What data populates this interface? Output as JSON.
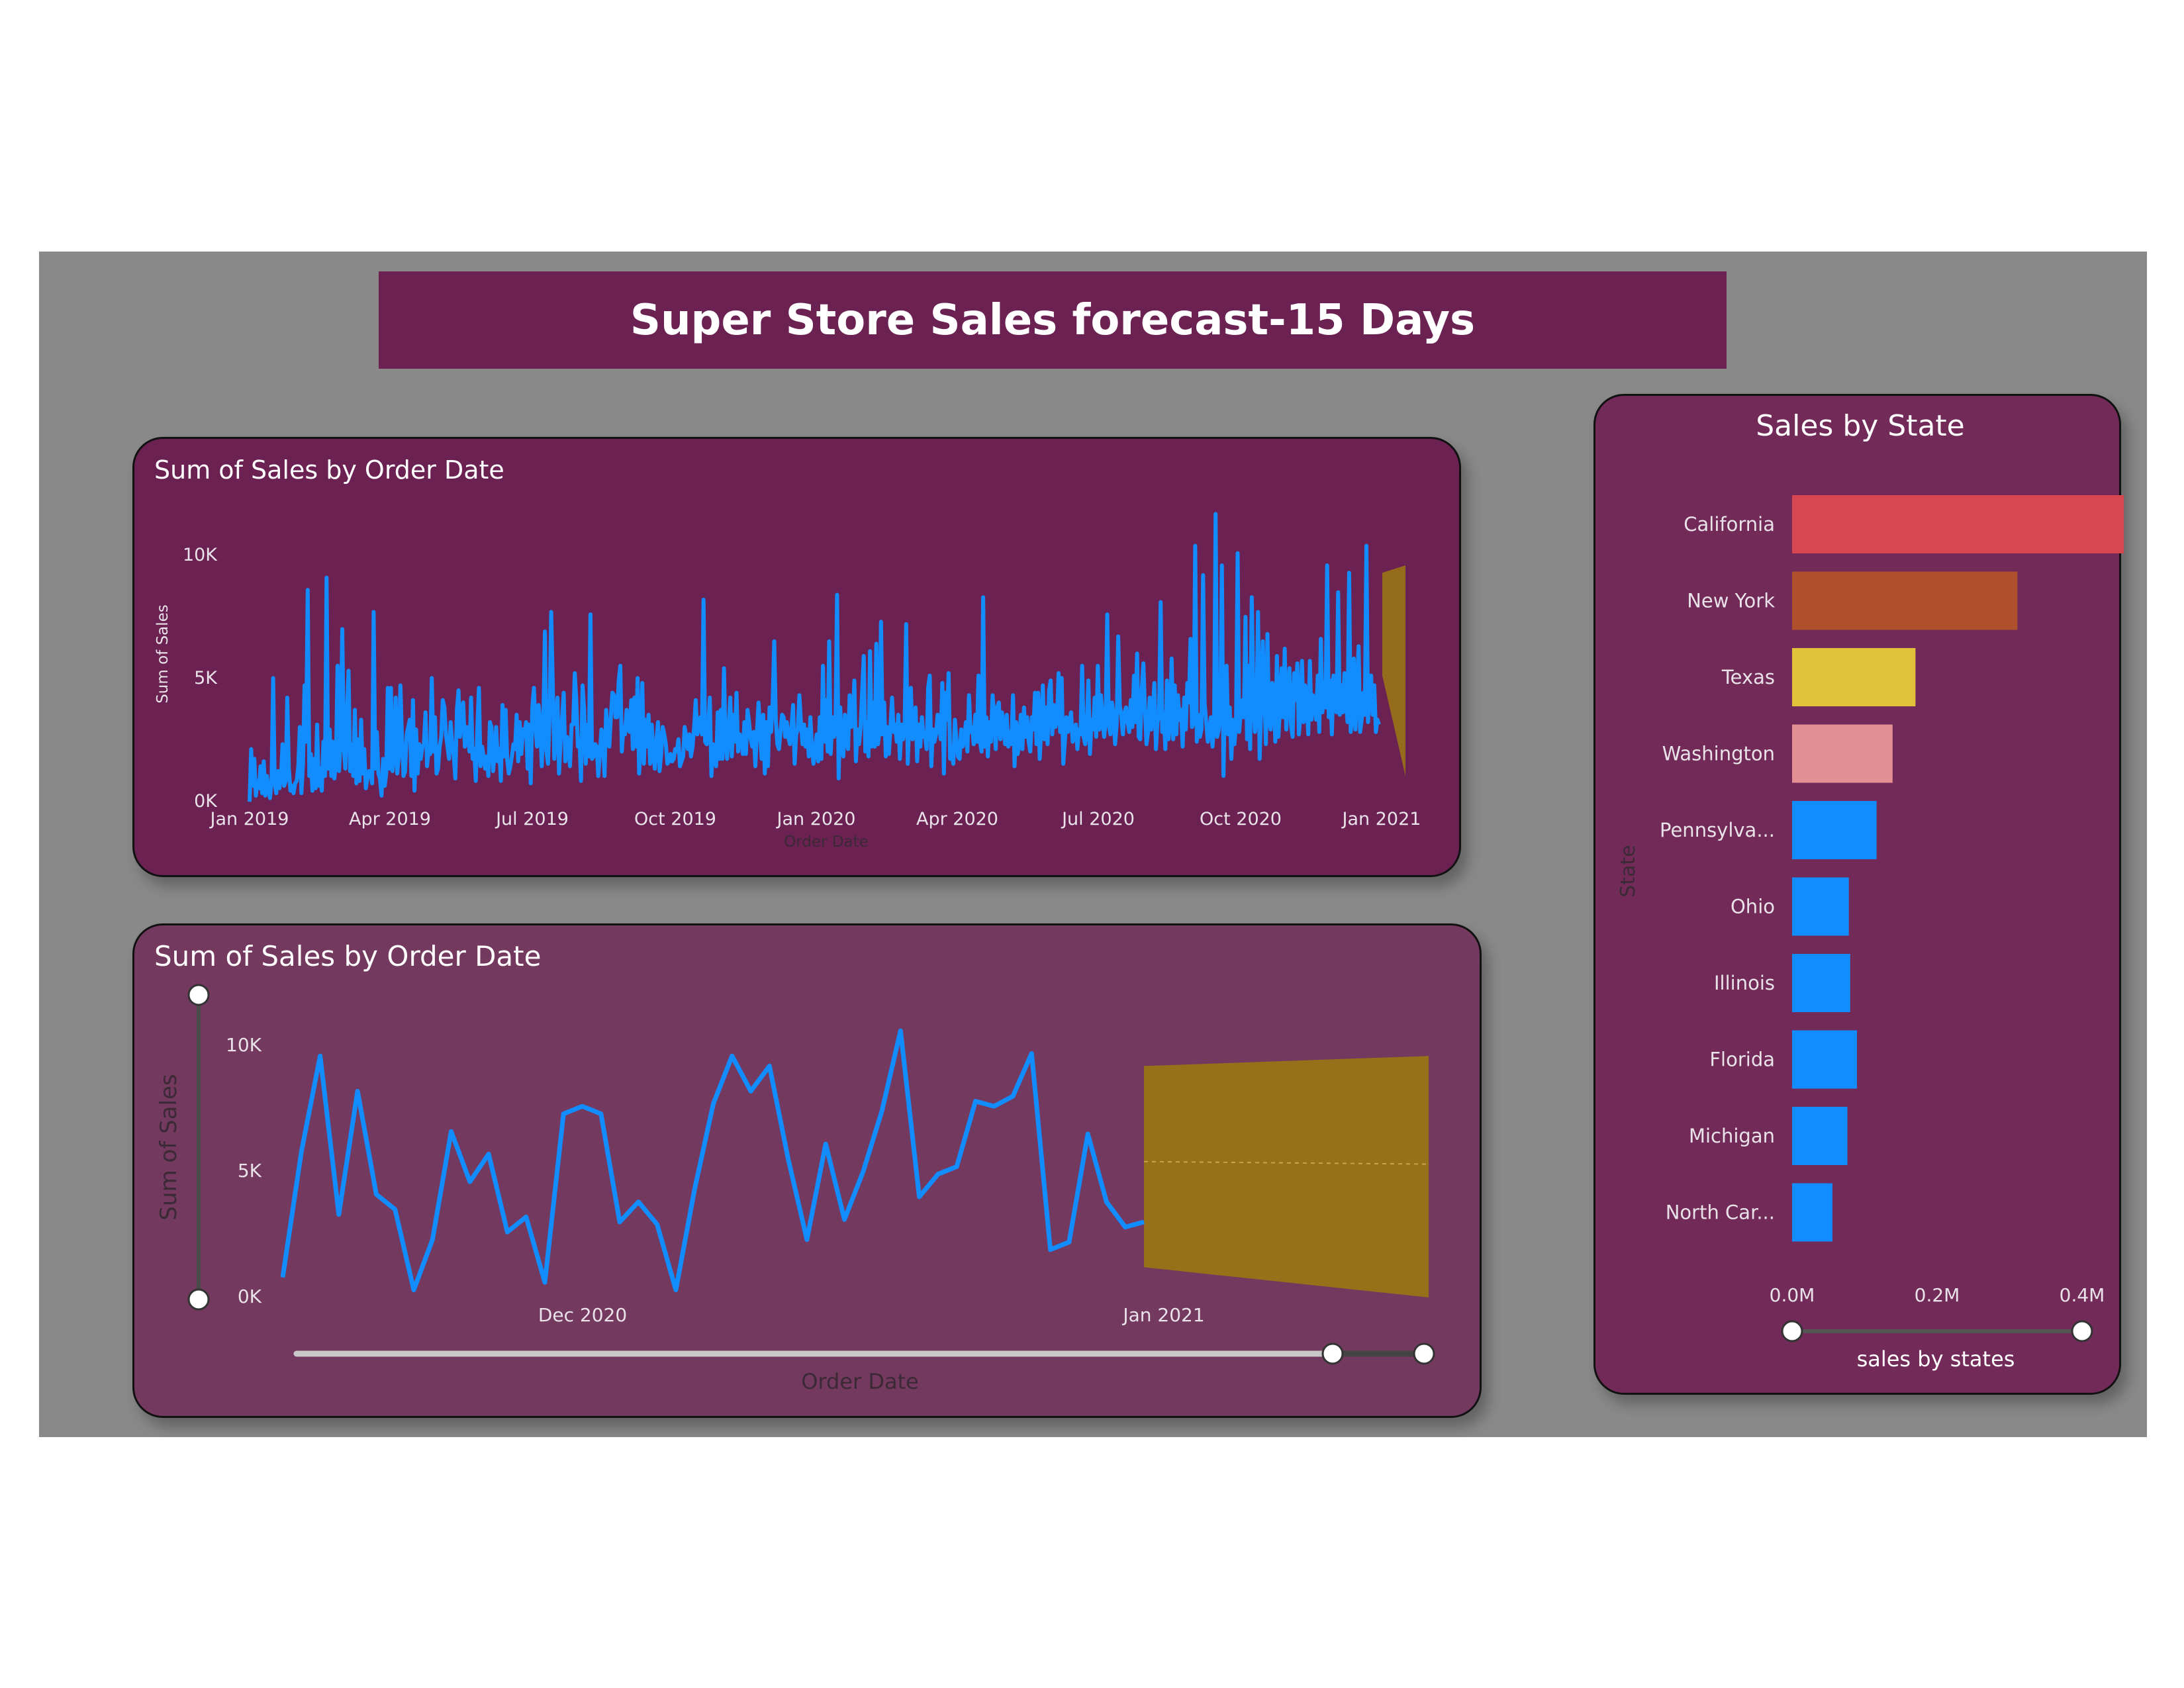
{
  "title": "Super Store Sales forecast-15 Days",
  "colors": {
    "canvas": "#898989",
    "banner": "#6b2253",
    "line": "#118dff",
    "forecast": "#9a7316"
  },
  "chart_data": [
    {
      "type": "line",
      "title": "Sum of Sales by Order Date",
      "xlabel": "Order Date",
      "ylabel": "Sum of Sales",
      "x_ticks": [
        "Jan 2019",
        "Apr 2019",
        "Jul 2019",
        "Oct 2019",
        "Jan 2020",
        "Apr 2020",
        "Jul 2020",
        "Oct 2020",
        "Jan 2021"
      ],
      "y_ticks": [
        "0K",
        "5K",
        "10K"
      ],
      "x_range": [
        "2019-01-01",
        "2021-01-14"
      ],
      "ylim": [
        0,
        11500
      ],
      "series": [
        {
          "values": [
            50,
            2200,
            700,
            1800,
            300,
            900,
            600,
            1500,
            400,
            1700,
            300,
            1100,
            600,
            200,
            900,
            5100,
            800,
            400,
            1300,
            600,
            1100,
            2400,
            700,
            900,
            4300,
            1400,
            500,
            700,
            400,
            800,
            900,
            1500,
            3100,
            400,
            1600,
            4800,
            2500,
            8700,
            1100,
            2000,
            500,
            1800,
            600,
            3200,
            700,
            1400,
            500,
            2500,
            1100,
            9200,
            1400,
            3000,
            1100,
            2500,
            1000,
            1700,
            5600,
            1300,
            2800,
            7100,
            2200,
            1400,
            3700,
            5400,
            1300,
            2400,
            1100,
            3800,
            800,
            2600,
            900,
            3400,
            1200,
            2200,
            600,
            1000,
            1300,
            1300,
            800,
            7800,
            1400,
            2900,
            1200,
            1000,
            300,
            1800,
            700,
            1200,
            4700,
            1400,
            4700,
            1300,
            2000,
            4300,
            1200,
            1900,
            4800,
            2700,
            1100,
            1300,
            2800,
            3100,
            3400,
            1100,
            4200,
            500,
            3000,
            1200,
            2400,
            1800,
            2300,
            2400,
            3700,
            1500,
            2200,
            2000,
            5100,
            2100,
            3500,
            1200,
            1400,
            2300,
            2700,
            4200,
            3900,
            2800,
            2300,
            1800,
            3300,
            2400,
            1900,
            1000,
            3800,
            4600,
            2700,
            3600,
            4100,
            2300,
            3100,
            2800,
            2100,
            4300,
            1800,
            2200,
            900,
            3000,
            4700,
            1500,
            2300,
            1900,
            1400,
            1900,
            1100,
            3300,
            3100,
            1300,
            2000,
            3100,
            1700,
            2200,
            900,
            4000,
            1900,
            3800,
            1800,
            1200,
            1500,
            1900,
            2400,
            2200,
            3600,
            1700,
            3300,
            2000,
            3000,
            2700,
            3300,
            1400,
            3200,
            800,
            3900,
            4700,
            3100,
            2300,
            4000,
            3300,
            1500,
            3300,
            7000,
            2100,
            1600,
            3700,
            7800,
            4900,
            1800,
            3300,
            4300,
            1200,
            2500,
            3500,
            4500,
            1700,
            2700,
            2300,
            1500,
            3200,
            3200,
            5300,
            4200,
            2300,
            2600,
            900,
            4800,
            3800,
            1600,
            3200,
            1900,
            7700,
            1800,
            1900,
            2400,
            2300,
            1100,
            2000,
            3000,
            2500,
            1100,
            3800,
            2900,
            2300,
            3500,
            4500,
            4400,
            3500,
            3500,
            5000,
            5600,
            2100,
            3100,
            2800,
            3800,
            3000,
            2900,
            4200,
            2200,
            4300,
            2300,
            5100,
            1200,
            2400,
            4900,
            1600,
            3400,
            2300,
            3600,
            1600,
            3200,
            2100,
            1400,
            2500,
            3300,
            1300,
            2000,
            3100,
            2800,
            2400,
            1600,
            1700,
            2000,
            1700,
            1800,
            2200,
            2100,
            2600,
            1500,
            1700,
            1900,
            3100,
            2700,
            2200,
            2800,
            1900,
            2300,
            3100,
            4200,
            2800,
            3100,
            3500,
            2800,
            8300,
            2500,
            2400,
            3000,
            4300,
            1100,
            2400,
            2300,
            1500,
            3700,
            1800,
            3800,
            1800,
            5500,
            2500,
            1800,
            3100,
            4300,
            1900,
            3600,
            2500,
            4500,
            2100,
            2800,
            2700,
            2000,
            3300,
            2000,
            3800,
            3300,
            2600,
            2300,
            2900,
            1500,
            2900,
            4100,
            2900,
            1800,
            3600,
            1200,
            3300,
            1500,
            3900,
            2900,
            4100,
            6600,
            3400,
            2400,
            2200,
            2900,
            3600,
            3500,
            2700,
            3300,
            2700,
            2400,
            3100,
            4000,
            1600,
            2800,
            3000,
            4400,
            3300,
            2400,
            3200,
            2300,
            3000,
            1900,
            3500,
            2300,
            1600,
            2200,
            2800,
            1700,
            3500,
            1800,
            5600,
            2500,
            4200,
            2100,
            6600,
            2000,
            3500,
            2700,
            3000,
            8500,
            1000,
            3900,
            2400,
            1900,
            3600,
            2600,
            2200,
            4400,
            3100,
            3200,
            5000,
            1700,
            3000,
            2400,
            3100,
            4600,
            6000,
            2100,
            3300,
            1900,
            6200,
            2300,
            4100,
            2300,
            6500,
            2400,
            2900,
            7400,
            2800,
            4100,
            1900,
            3100,
            2000,
            3100,
            4300,
            2900,
            3200,
            2500,
            3600,
            1800,
            3200,
            2600,
            3000,
            7300,
            1600,
            3500,
            4700,
            2600,
            2800,
            3900,
            1700,
            3200,
            2300,
            3500,
            2700,
            2800,
            2200,
            4700,
            5200,
            1500,
            3000,
            2500,
            2800,
            3600,
            3300,
            2600,
            4900,
            1200,
            4500,
            3400,
            5300,
            1800,
            2200,
            1600,
            3400,
            2600,
            1900,
            1800,
            3000,
            2300,
            2600,
            3300,
            2100,
            4400,
            2900,
            3100,
            2400,
            3600,
            2500,
            5200,
            2500,
            2100,
            8400,
            2300,
            3500,
            1900,
            3300,
            2500,
            4400,
            3600,
            2200,
            3900,
            4100,
            2600,
            3700,
            3200,
            2400,
            3600,
            2300,
            2900,
            2400,
            4400,
            1500,
            3300,
            2000,
            2400,
            3600,
            2200,
            3900,
            2700,
            3500,
            2500,
            2100,
            3500,
            3000,
            4500,
            2400,
            4500,
            1800,
            3100,
            4800,
            2600,
            3900,
            2400,
            4600,
            5000,
            2800,
            4000,
            3100,
            3400,
            5300,
            2900,
            5100,
            1600,
            2500,
            3500,
            2900,
            3300,
            3700,
            2500,
            2800,
            3200,
            2200,
            3000,
            2800,
            5600,
            2700,
            2400,
            3100,
            5000,
            2000,
            3400,
            3000,
            4300,
            2700,
            5600,
            3000,
            4400,
            3500,
            2700,
            3300,
            7700,
            3200,
            2800,
            4100,
            3600,
            2400,
            3200,
            6800,
            4000,
            3500,
            2800,
            3700,
            3900,
            3300,
            2900,
            4200,
            3100,
            5200,
            3300,
            6100,
            2700,
            2600,
            4600,
            5700,
            3800,
            2400,
            2900,
            4300,
            3000,
            3700,
            4900,
            2200,
            3300,
            3600,
            8200,
            2900,
            3700,
            2200,
            5000,
            2600,
            3300,
            5900,
            2600,
            4800,
            2800,
            4400,
            3400,
            3800,
            2300,
            4300,
            3000,
            4900,
            4100,
            6700,
            3100,
            3300,
            10500,
            2500,
            3600,
            2700,
            3000,
            9300,
            4100,
            3300,
            2500,
            2900,
            3500,
            2300,
            3200,
            11800,
            2700,
            3000,
            3700,
            9700,
            1100,
            4700,
            5600,
            2800,
            3900,
            1800,
            3400,
            2400,
            3300,
            10200,
            2900,
            3700,
            4200,
            3500,
            7600,
            2600,
            5600,
            2200,
            8400,
            4500,
            2900,
            3500,
            7800,
            1800,
            3800,
            6600,
            4600,
            2400,
            6900,
            3400,
            3000,
            4900,
            4600,
            2500,
            6000,
            2700,
            3900,
            5500,
            3500,
            6300,
            3000,
            4500,
            5500,
            3200,
            2700,
            5300,
            4200,
            5700,
            2800,
            3600,
            5800,
            3300,
            4800,
            4000,
            2800,
            5800,
            3400,
            4400,
            4100,
            3400,
            5200,
            2900,
            6700,
            3700,
            4900,
            3900,
            9700,
            3500,
            5000,
            2800,
            5200,
            4400,
            3700,
            8600,
            3600,
            4800,
            3700,
            5300,
            4200,
            3300,
            9400,
            2900,
            3600,
            5900,
            3000,
            4600,
            6400,
            2900,
            3400,
            4500,
            3600,
            10500,
            3300,
            4600,
            5200,
            3600,
            4800,
            2900,
            3400,
            3200
          ]
        }
      ],
      "forecast_band": {
        "lower": [
          1100,
          5200
        ],
        "upper": [
          9400,
          9700
        ]
      }
    },
    {
      "type": "line",
      "title": "Sum of Sales by Order Date",
      "xlabel": "Order Date",
      "ylabel": "Sum of Sales",
      "x_ticks": [
        "Dec 2020",
        "Jan 2021"
      ],
      "y_ticks": [
        "0K",
        "5K",
        "10K"
      ],
      "x_range": [
        "2020-11-15",
        "2021-01-31"
      ],
      "ylim": [
        0,
        11000
      ],
      "series": [
        {
          "values": [
            800,
            5800,
            9600,
            3300,
            8200,
            4100,
            3500,
            300,
            2300,
            6600,
            4600,
            5700,
            2600,
            3200,
            600,
            7300,
            7600,
            7300,
            3000,
            3800,
            2900,
            300,
            4300,
            7700,
            9600,
            8200,
            9200,
            5500,
            2300,
            6100,
            3100,
            5000,
            7400,
            10600,
            4000,
            4900,
            5200,
            7800,
            7600,
            8000,
            9700,
            1900,
            2200,
            6500,
            3800,
            2800,
            3000
          ]
        }
      ],
      "forecast_band": {
        "lower": [
          1200,
          0
        ],
        "upper": [
          9200,
          9600
        ]
      }
    },
    {
      "type": "bar",
      "title": "Sales by State",
      "xlabel": "sales by states",
      "ylabel": "State",
      "categories": [
        "California",
        "New York",
        "Texas",
        "Washington",
        "Pennsylva...",
        "Ohio",
        "Illinois",
        "Florida",
        "Michigan",
        "North Car..."
      ],
      "values": [
        457688,
        310876,
        170188,
        138641,
        116512,
        78258,
        80166,
        89474,
        76270,
        55603
      ],
      "bar_colors": [
        "#d84652",
        "#ae502b",
        "#e0c33a",
        "#e48f94",
        "#118dff",
        "#118dff",
        "#118dff",
        "#118dff",
        "#118dff",
        "#118dff"
      ],
      "x_ticks": [
        "0.0M",
        "0.2M",
        "0.4M"
      ],
      "xlim": [
        0,
        0.9
      ]
    }
  ]
}
